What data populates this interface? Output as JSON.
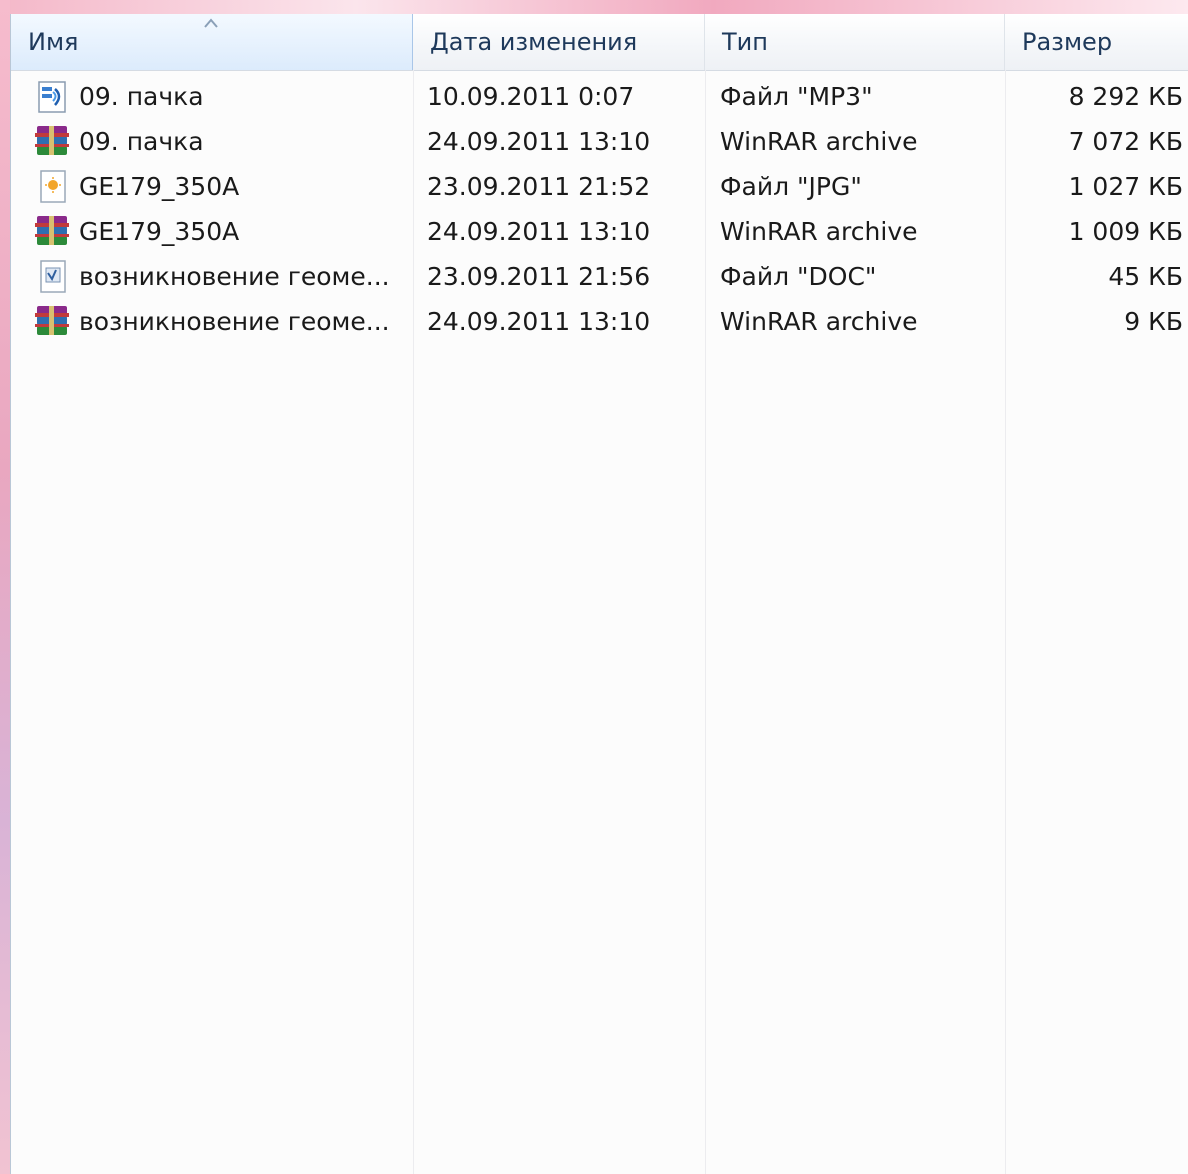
{
  "columns": {
    "name": "Имя",
    "date": "Дата изменения",
    "type": "Тип",
    "size": "Размер"
  },
  "files": [
    {
      "icon": "mp3-file-icon",
      "name": "09. пачка",
      "date": "10.09.2011 0:07",
      "type": "Файл \"MP3\"",
      "size": "8 292 КБ"
    },
    {
      "icon": "winrar-archive-icon",
      "name": "09. пачка",
      "date": "24.09.2011 13:10",
      "type": "WinRAR archive",
      "size": "7 072 КБ"
    },
    {
      "icon": "jpg-file-icon",
      "name": "GE179_350A",
      "date": "23.09.2011 21:52",
      "type": "Файл \"JPG\"",
      "size": "1 027 КБ"
    },
    {
      "icon": "winrar-archive-icon",
      "name": "GE179_350A",
      "date": "24.09.2011 13:10",
      "type": "WinRAR archive",
      "size": "1 009 КБ"
    },
    {
      "icon": "doc-file-icon",
      "name": "возникновение геоме...",
      "date": "23.09.2011 21:56",
      "type": "Файл \"DOC\"",
      "size": "45 КБ"
    },
    {
      "icon": "winrar-archive-icon",
      "name": "возникновение геоме...",
      "date": "24.09.2011 13:10",
      "type": "WinRAR archive",
      "size": "9 КБ"
    }
  ],
  "colors": {
    "header_text": "#1e395b",
    "background_pink": "#f3b9cb",
    "list_background": "#fcfcfc"
  }
}
